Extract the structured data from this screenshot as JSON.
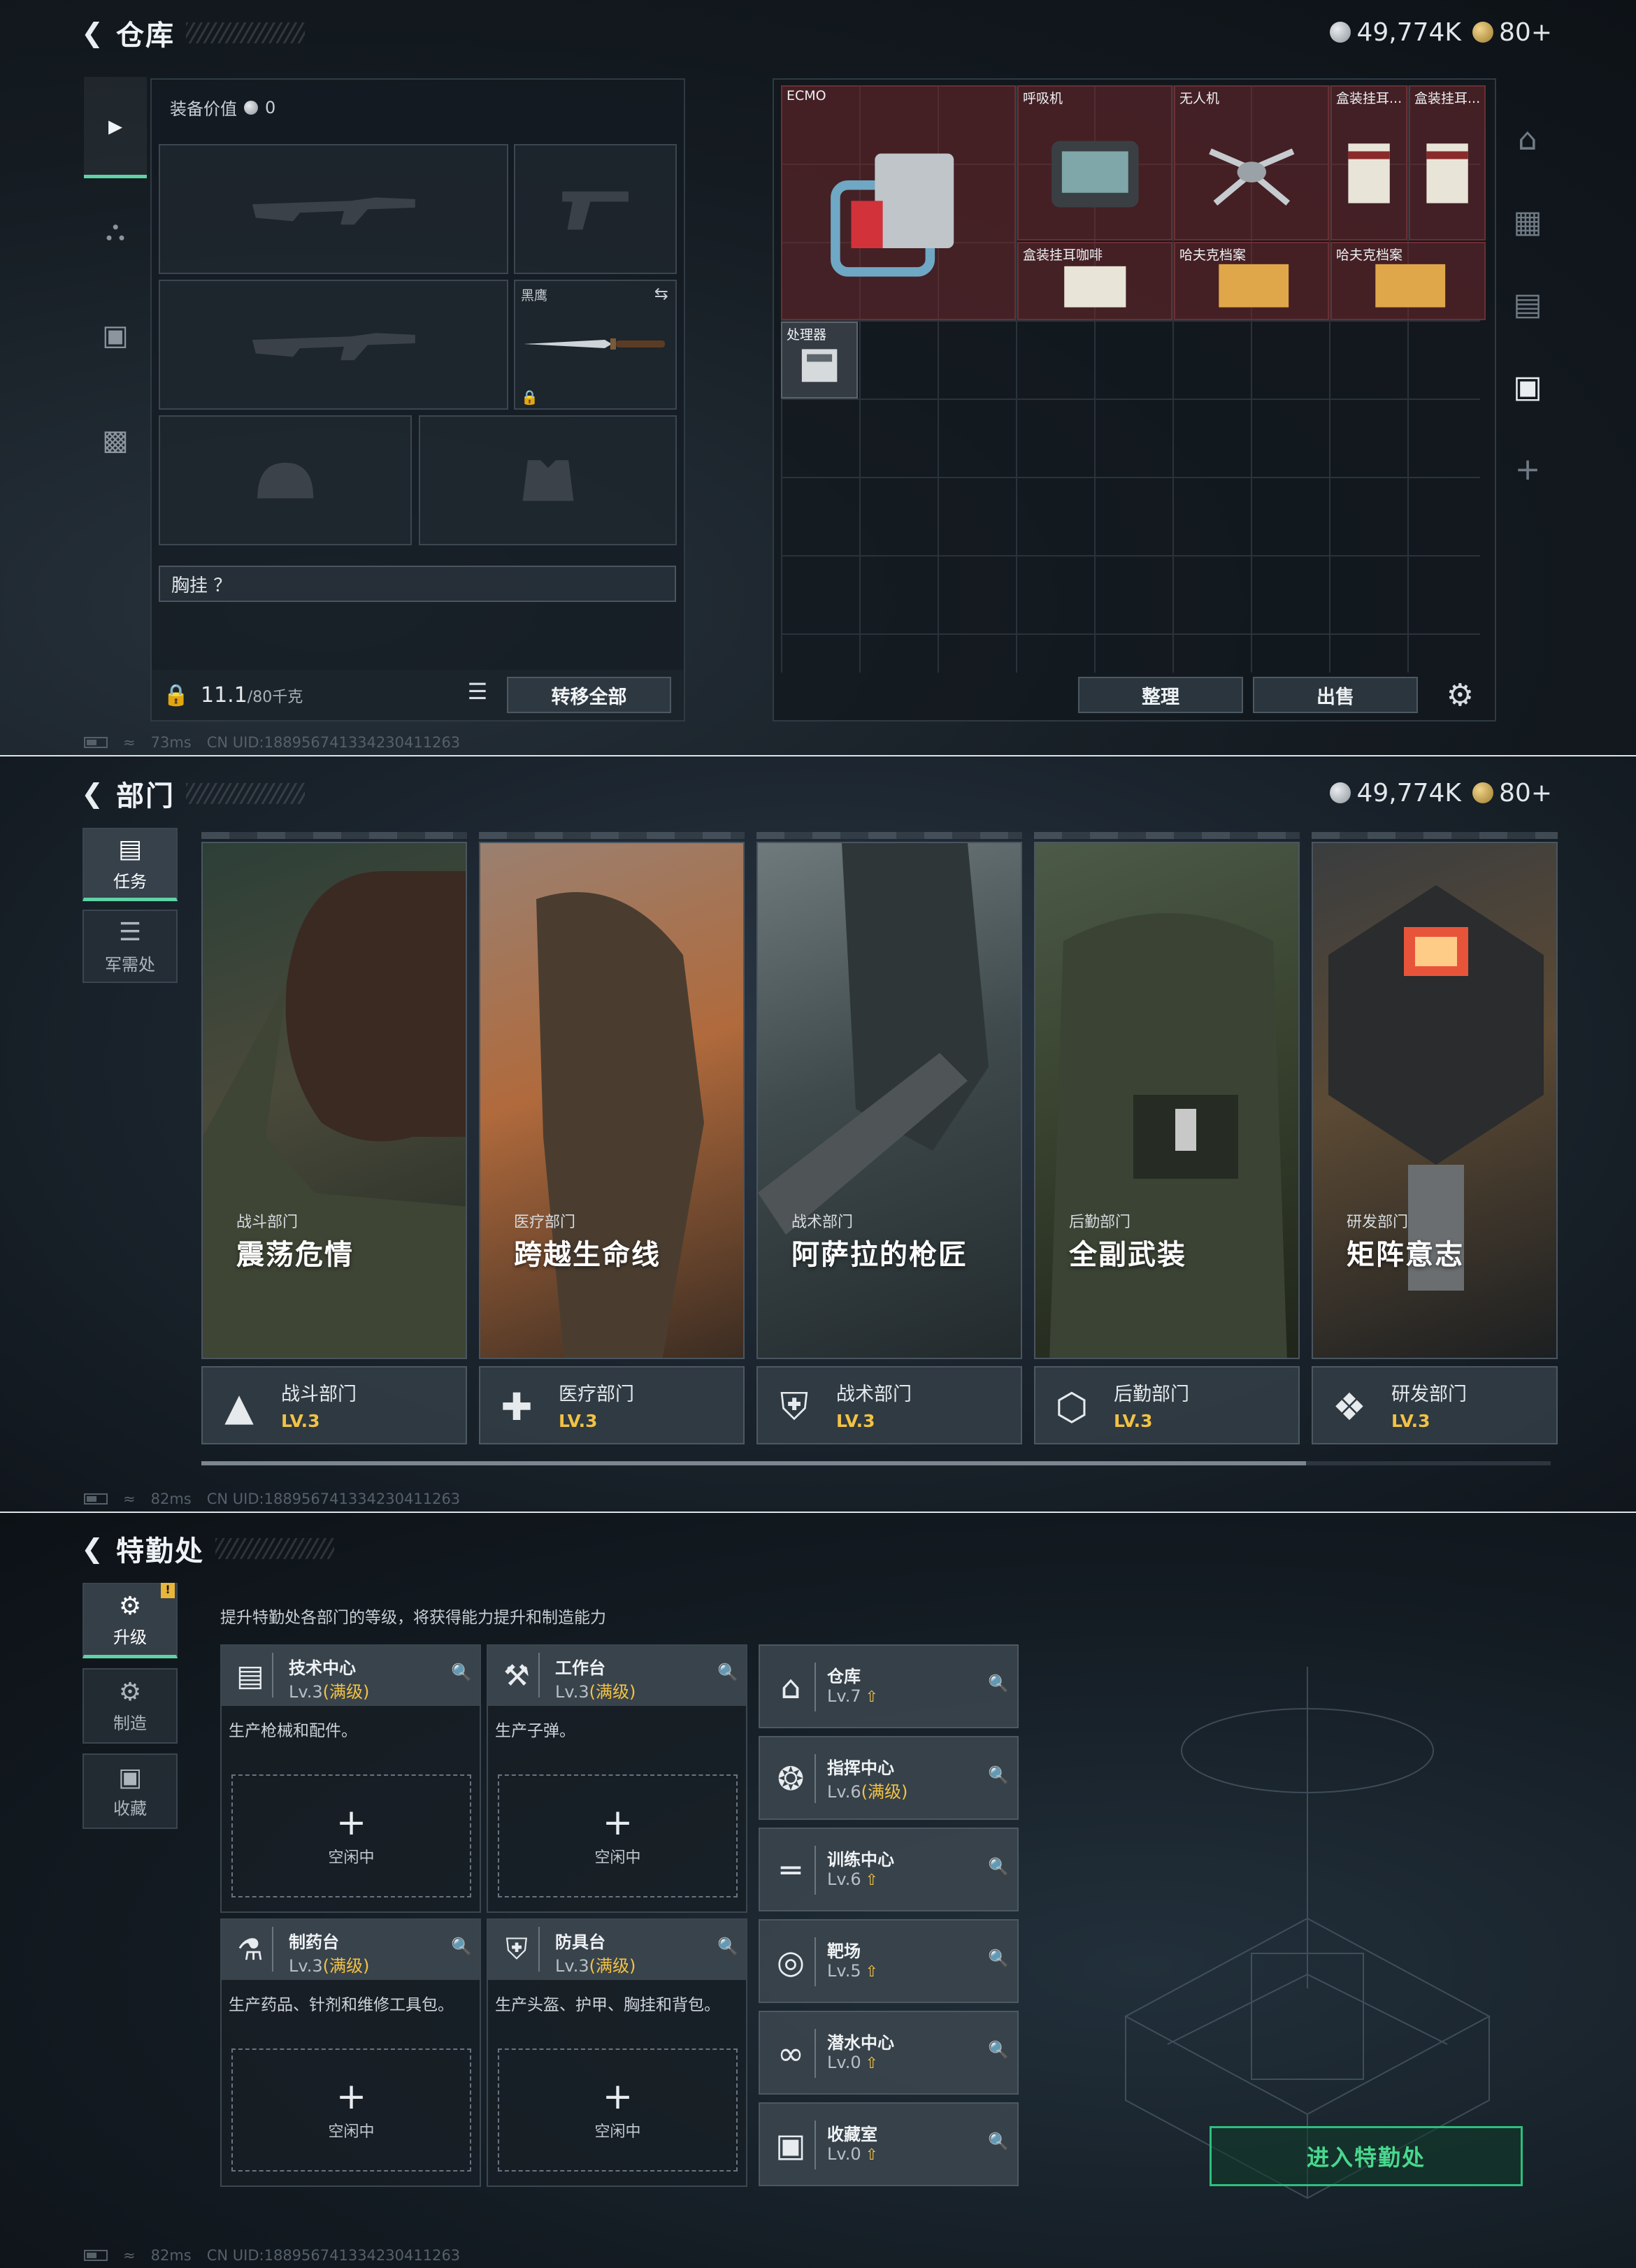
{
  "currency": {
    "silver": "49,774K",
    "gold": "80+"
  },
  "status": {
    "ping1": "73ms",
    "ping2": "82ms",
    "ping3": "82ms",
    "uid": "CN UID:1889567413342304112​63"
  },
  "warehouse": {
    "title": "仓库",
    "equip_value_label": "装备价值",
    "equip_value": "0",
    "knife_label": "黑鹰",
    "chest_label": "胸挂 ？",
    "weight": "11.1",
    "weight_unit": "/80千克",
    "transfer_all": "转移全部",
    "tidy": "整理",
    "sell": "出售",
    "items": {
      "ecmo": "ECMO",
      "ventilator": "呼吸机",
      "drone": "无人机",
      "box1": "盒装挂耳...",
      "box2": "盒装挂耳...",
      "box3": "盒装挂耳咖啡",
      "file1": "哈夫克档案",
      "file2": "哈夫克档案",
      "processor": "处理器"
    }
  },
  "departments": {
    "title": "部门",
    "tabs": [
      "任务",
      "军需处"
    ],
    "cards": [
      {
        "sub": "战斗部门",
        "title": "震荡危情",
        "dept": "战斗部门",
        "lv": "LV.3",
        "icon": "combat-icon"
      },
      {
        "sub": "医疗部门",
        "title": "跨越生命线",
        "dept": "医疗部门",
        "lv": "LV.3",
        "icon": "medical-icon"
      },
      {
        "sub": "战术部门",
        "title": "阿萨拉的枪匠",
        "dept": "战术部门",
        "lv": "LV.3",
        "icon": "tactical-icon"
      },
      {
        "sub": "后勤部门",
        "title": "全副武装",
        "dept": "后勤部门",
        "lv": "LV.3",
        "icon": "logistics-icon"
      },
      {
        "sub": "研发部门",
        "title": "矩阵意志",
        "dept": "研发部门",
        "lv": "LV.3",
        "icon": "rnd-icon"
      }
    ]
  },
  "specops": {
    "title": "特勤处",
    "tabs": [
      "升级",
      "制造",
      "收藏"
    ],
    "badge": "!",
    "hint": "提升特勤处各部门的等级，将获得能力提升和制造能力",
    "benches": [
      {
        "name": "技术中心",
        "lv": "Lv.3",
        "max": "(满级)",
        "desc": "生产枪械和配件。",
        "idle": "空闲中",
        "icon": "tech-center-icon"
      },
      {
        "name": "工作台",
        "lv": "Lv.3",
        "max": "(满级)",
        "desc": "生产子弹。",
        "idle": "空闲中",
        "icon": "workbench-icon"
      },
      {
        "name": "制药台",
        "lv": "Lv.3",
        "max": "(满级)",
        "desc": "生产药品、针剂和维修工具包。",
        "idle": "空闲中",
        "icon": "pharmacy-icon"
      },
      {
        "name": "防具台",
        "lv": "Lv.3",
        "max": "(满级)",
        "desc": "生产头盔、护甲、胸挂和背包。",
        "idle": "空闲中",
        "icon": "armor-bench-icon"
      }
    ],
    "facilities": [
      {
        "name": "仓库",
        "lv": "Lv.7",
        "max": "",
        "up": true
      },
      {
        "name": "指挥中心",
        "lv": "Lv.6",
        "max": "(满级)",
        "up": false
      },
      {
        "name": "训练中心",
        "lv": "Lv.6",
        "max": "",
        "up": true
      },
      {
        "name": "靶场",
        "lv": "Lv.5",
        "max": "",
        "up": true
      },
      {
        "name": "潜水中心",
        "lv": "Lv.0",
        "max": "",
        "up": true
      },
      {
        "name": "收藏室",
        "lv": "Lv.0",
        "max": "",
        "up": true
      }
    ],
    "enter": "进入特勤处"
  }
}
